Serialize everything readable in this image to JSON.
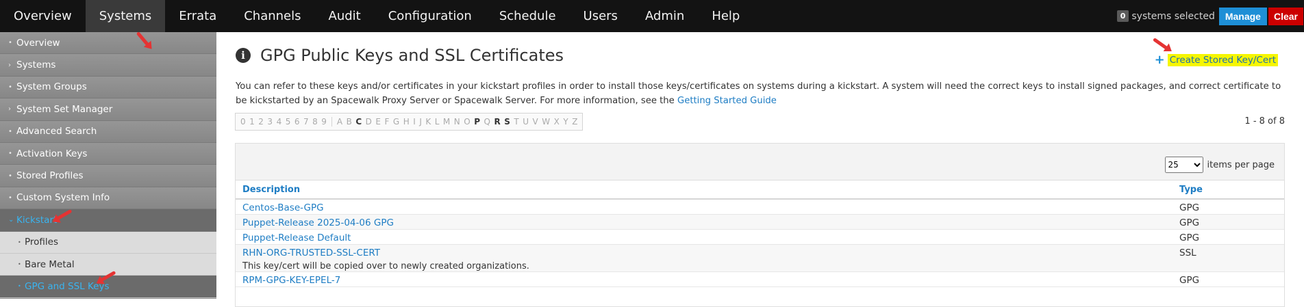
{
  "topnav": {
    "items": [
      "Overview",
      "Systems",
      "Errata",
      "Channels",
      "Audit",
      "Configuration",
      "Schedule",
      "Users",
      "Admin",
      "Help"
    ],
    "selected_count": "0",
    "selected_text": "systems selected",
    "manage_label": "Manage",
    "clear_label": "Clear"
  },
  "sidebar": {
    "items": [
      "Overview",
      "Systems",
      "System Groups",
      "System Set Manager",
      "Advanced Search",
      "Activation Keys",
      "Stored Profiles",
      "Custom System Info",
      "Kickstart"
    ],
    "sub_items": [
      "Profiles",
      "Bare Metal",
      "GPG and SSL Keys"
    ]
  },
  "page": {
    "title": "GPG Public Keys and SSL Certificates",
    "create_link": "Create Stored Key/Cert",
    "description": "You can refer to these keys and/or certificates in your kickstart profiles in order to install those keys/certificates on systems during a kickstart. A system will need the correct keys to install signed packages, and correct certificate to be kickstarted by an Spacewalk Proxy Server or Spacewalk Server. For more information, see the",
    "guide_link": "Getting Started Guide",
    "count_text": "1 - 8 of 8",
    "items_per_page_value": "25",
    "items_per_page_label": "items per page"
  },
  "alpha_bar": {
    "digits": [
      "0",
      "1",
      "2",
      "3",
      "4",
      "5",
      "6",
      "7",
      "8",
      "9"
    ],
    "letters": [
      "A",
      "B",
      "C",
      "D",
      "E",
      "F",
      "G",
      "H",
      "I",
      "J",
      "K",
      "L",
      "M",
      "N",
      "O",
      "P",
      "Q",
      "R",
      "S",
      "T",
      "U",
      "V",
      "W",
      "X",
      "Y",
      "Z"
    ],
    "active_letters": [
      "C",
      "P",
      "R",
      "S"
    ]
  },
  "table": {
    "headers": [
      "Description",
      "Type"
    ],
    "rows": [
      {
        "description": "Centos-Base-GPG",
        "type": "GPG",
        "note": ""
      },
      {
        "description": "Puppet-Release 2025-04-06 GPG",
        "type": "GPG",
        "note": ""
      },
      {
        "description": "Puppet-Release Default",
        "type": "GPG",
        "note": ""
      },
      {
        "description": "RHN-ORG-TRUSTED-SSL-CERT",
        "type": "SSL",
        "note": "This key/cert will be copied over to newly created organizations."
      },
      {
        "description": "RPM-GPG-KEY-EPEL-7",
        "type": "GPG",
        "note": ""
      }
    ]
  },
  "colors": {
    "nav_bg": "#131313",
    "link": "#1e7dc4",
    "active_sidebar": "#39b4f0",
    "highlight": "#f6f600",
    "manage": "#1e8fd6",
    "clear": "#cc0000"
  }
}
